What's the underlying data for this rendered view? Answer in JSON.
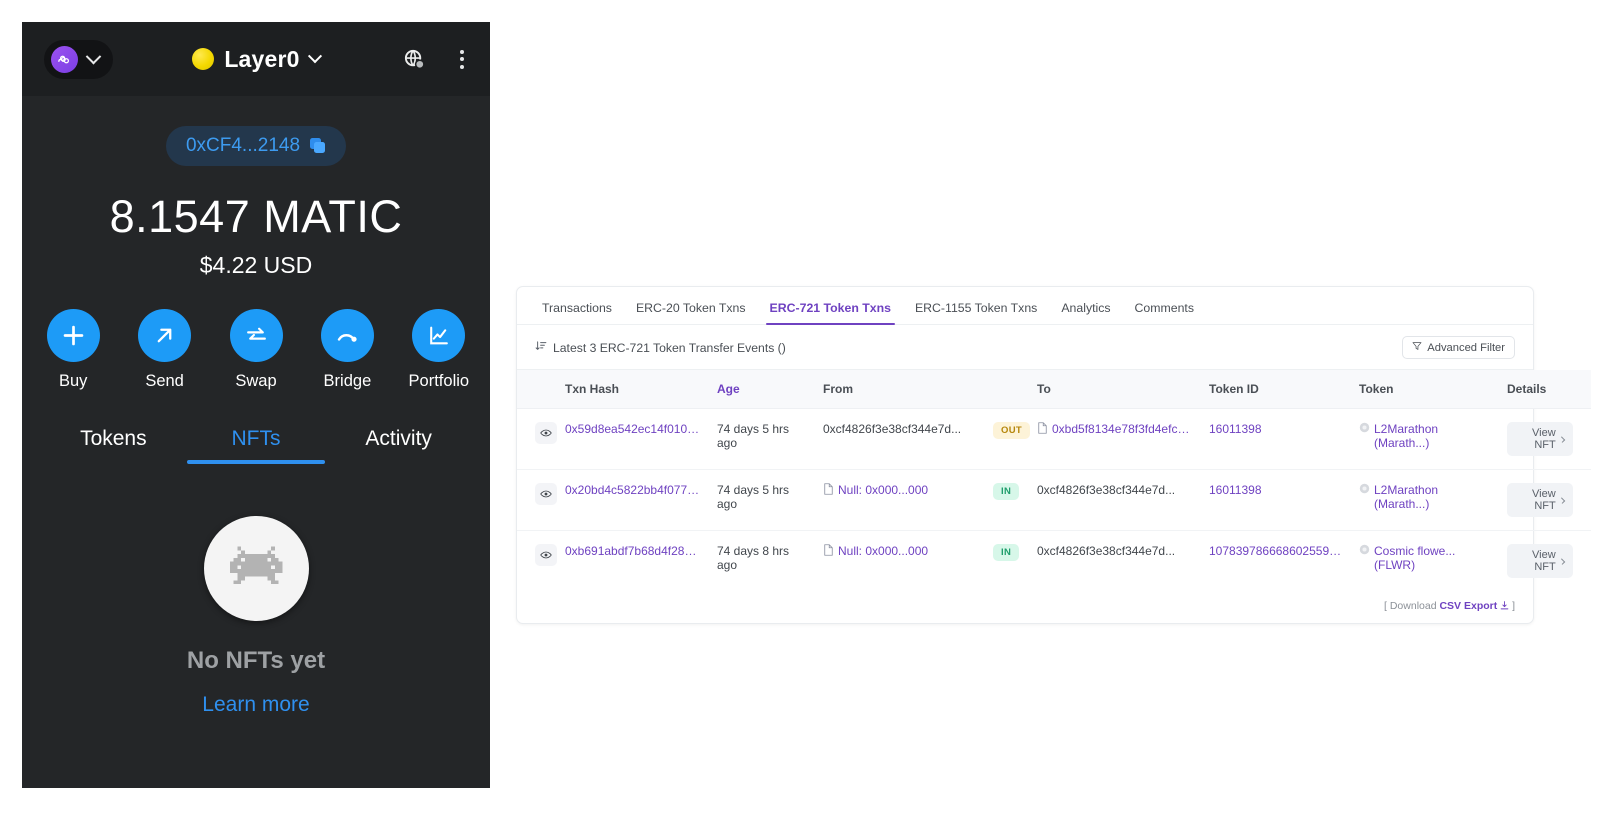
{
  "wallet": {
    "header": {
      "account_icon": "infinity-avatar-icon",
      "account_chevron": "chevron-down-icon",
      "network_dot": "matic-network-dot-icon",
      "network_name": "Layer0",
      "network_chevron": "chevron-down-icon",
      "globe_icon": "globe-network-icon",
      "menu_icon": "kebab-menu-icon"
    },
    "address": "0xCF4...2148",
    "copy_icon": "copy-icon",
    "balance": "8.1547 MATIC",
    "fiat_balance": "$4.22 USD",
    "actions": [
      {
        "label": "Buy",
        "icon": "plus-icon"
      },
      {
        "label": "Send",
        "icon": "arrow-up-right-icon"
      },
      {
        "label": "Swap",
        "icon": "swap-arrows-icon"
      },
      {
        "label": "Bridge",
        "icon": "bridge-icon"
      },
      {
        "label": "Portfolio",
        "icon": "line-chart-icon"
      }
    ],
    "tabs": [
      {
        "label": "Tokens",
        "active": false
      },
      {
        "label": "NFTs",
        "active": true
      },
      {
        "label": "Activity",
        "active": false
      }
    ],
    "empty_state": {
      "icon": "space-invader-icon",
      "title": "No NFTs yet",
      "link": "Learn more"
    },
    "colors": {
      "accent": "#2f90ef",
      "panel_bg": "#242628",
      "header_bg": "#1d1f21"
    }
  },
  "explorer": {
    "tabs": [
      {
        "label": "Transactions",
        "active": false
      },
      {
        "label": "ERC-20 Token Txns",
        "active": false
      },
      {
        "label": "ERC-721 Token Txns",
        "active": true
      },
      {
        "label": "ERC-1155 Token Txns",
        "active": false
      },
      {
        "label": "Analytics",
        "active": false
      },
      {
        "label": "Comments",
        "active": false
      }
    ],
    "subbar": {
      "sort_icon": "sort-descending-icon",
      "summary": "Latest 3 ERC-721 Token Transfer Events ()",
      "filter_icon": "funnel-icon",
      "filter_label": "Advanced Filter"
    },
    "columns": [
      {
        "key": "eye",
        "label": "",
        "sorted": false
      },
      {
        "key": "hash",
        "label": "Txn Hash",
        "sorted": false
      },
      {
        "key": "age",
        "label": "Age",
        "sorted": true
      },
      {
        "key": "from",
        "label": "From",
        "sorted": false
      },
      {
        "key": "dir",
        "label": "",
        "sorted": false
      },
      {
        "key": "to",
        "label": "To",
        "sorted": false
      },
      {
        "key": "tokid",
        "label": "Token ID",
        "sorted": false
      },
      {
        "key": "token",
        "label": "Token",
        "sorted": false
      },
      {
        "key": "det",
        "label": "Details",
        "sorted": false
      }
    ],
    "rows": [
      {
        "eye_icon": "eye-icon",
        "hash": "0x59d8ea542ec14f0100...",
        "age": "74 days 5 hrs ago",
        "from": "0xcf4826f3e38cf344e7d...",
        "from_is_link": false,
        "from_icon": "",
        "direction": "OUT",
        "to": "0xbd5f8134e78f3fd4efc6...",
        "to_is_link": true,
        "to_icon": "contract-icon",
        "token_id": "16011398",
        "token_icon": "token-logo-icon",
        "token": "L2Marathon (Marath...)",
        "details_label": "View NFT",
        "details_chevron": "chevron-right-icon"
      },
      {
        "eye_icon": "eye-icon",
        "hash": "0x20bd4c5822bb4f0774...",
        "age": "74 days 5 hrs ago",
        "from": "Null: 0x000...000",
        "from_is_link": true,
        "from_icon": "contract-icon",
        "direction": "IN",
        "to": "0xcf4826f3e38cf344e7d...",
        "to_is_link": false,
        "to_icon": "",
        "token_id": "16011398",
        "token_icon": "token-logo-icon",
        "token": "L2Marathon (Marath...)",
        "details_label": "View NFT",
        "details_chevron": "chevron-right-icon"
      },
      {
        "eye_icon": "eye-icon",
        "hash": "0xb691abdf7b68d4f2888...",
        "age": "74 days 8 hrs ago",
        "from": "Null: 0x000...000",
        "from_is_link": true,
        "from_icon": "contract-icon",
        "direction": "IN",
        "to": "0xcf4826f3e38cf344e7d...",
        "to_is_link": false,
        "to_icon": "",
        "token_id": "10783978666860255917...",
        "token_icon": "token-logo-icon",
        "token": "Cosmic flowe... (FLWR)",
        "details_label": "View NFT",
        "details_chevron": "chevron-right-icon"
      }
    ],
    "footer": {
      "prefix": "[ Download ",
      "csv_label": "CSV Export",
      "download_icon": "download-icon",
      "suffix": " ]"
    },
    "colors": {
      "accent": "#6f42c1",
      "in_badge": "#1f9d6b",
      "out_badge": "#b5860b"
    }
  }
}
